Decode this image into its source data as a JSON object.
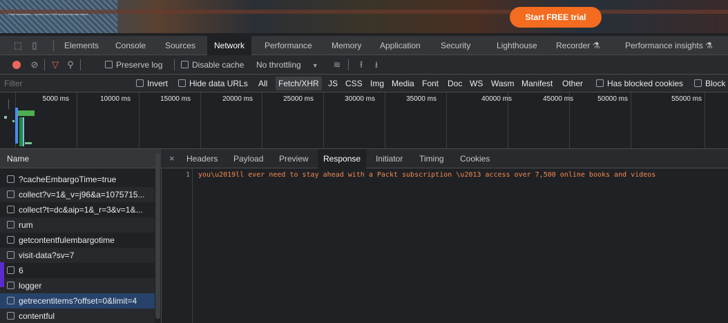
{
  "banner": {
    "tiny_text": "Packt subscription — access over 7,500 online books and videos",
    "cta_label": "Start FREE trial",
    "cta_color": "#f36c20"
  },
  "devtools_tabs": [
    "Elements",
    "Console",
    "Sources",
    "Network",
    "Performance",
    "Memory",
    "Application",
    "Security",
    "Lighthouse",
    "Recorder ⚗",
    "Performance insights ⚗"
  ],
  "active_tab": "Network",
  "toolbar": {
    "preserve_log": "Preserve log",
    "disable_cache": "Disable cache",
    "throttling": "No throttling"
  },
  "filter": {
    "placeholder": "Filter",
    "invert": "Invert",
    "hide_data_urls": "Hide data URLs",
    "types": [
      "All",
      "Fetch/XHR",
      "JS",
      "CSS",
      "Img",
      "Media",
      "Font",
      "Doc",
      "WS",
      "Wasm",
      "Manifest",
      "Other"
    ],
    "active_type": "Fetch/XHR",
    "has_blocked_cookies": "Has blocked cookies",
    "blocked_requests": "Block"
  },
  "timeline": {
    "ticks": [
      "5000 ms",
      "10000 ms",
      "15000 ms",
      "20000 ms",
      "25000 ms",
      "30000 ms",
      "35000 ms",
      "40000 ms",
      "45000 ms",
      "50000 ms",
      "55000 ms"
    ]
  },
  "requests": {
    "header": "Name",
    "rows": [
      "?cacheEmbargoTime=true",
      "collect?v=1&_v=j96&a=1075715...",
      "collect?t=dc&aip=1&_r=3&v=1&...",
      "rum",
      "getcontentfulembargotime",
      "visit-data?sv=7",
      "6",
      "logger",
      "getrecentitems?offset=0&limit=4",
      "contentful"
    ],
    "selected_index": 8
  },
  "detail": {
    "tabs": [
      "Headers",
      "Payload",
      "Preview",
      "Response",
      "Initiator",
      "Timing",
      "Cookies"
    ],
    "active_tab": "Response",
    "line_number": "1",
    "response_text": "you\\u2019ll ever need to stay ahead with a Packt subscription \\u2013 access over 7,500 online books and videos"
  }
}
